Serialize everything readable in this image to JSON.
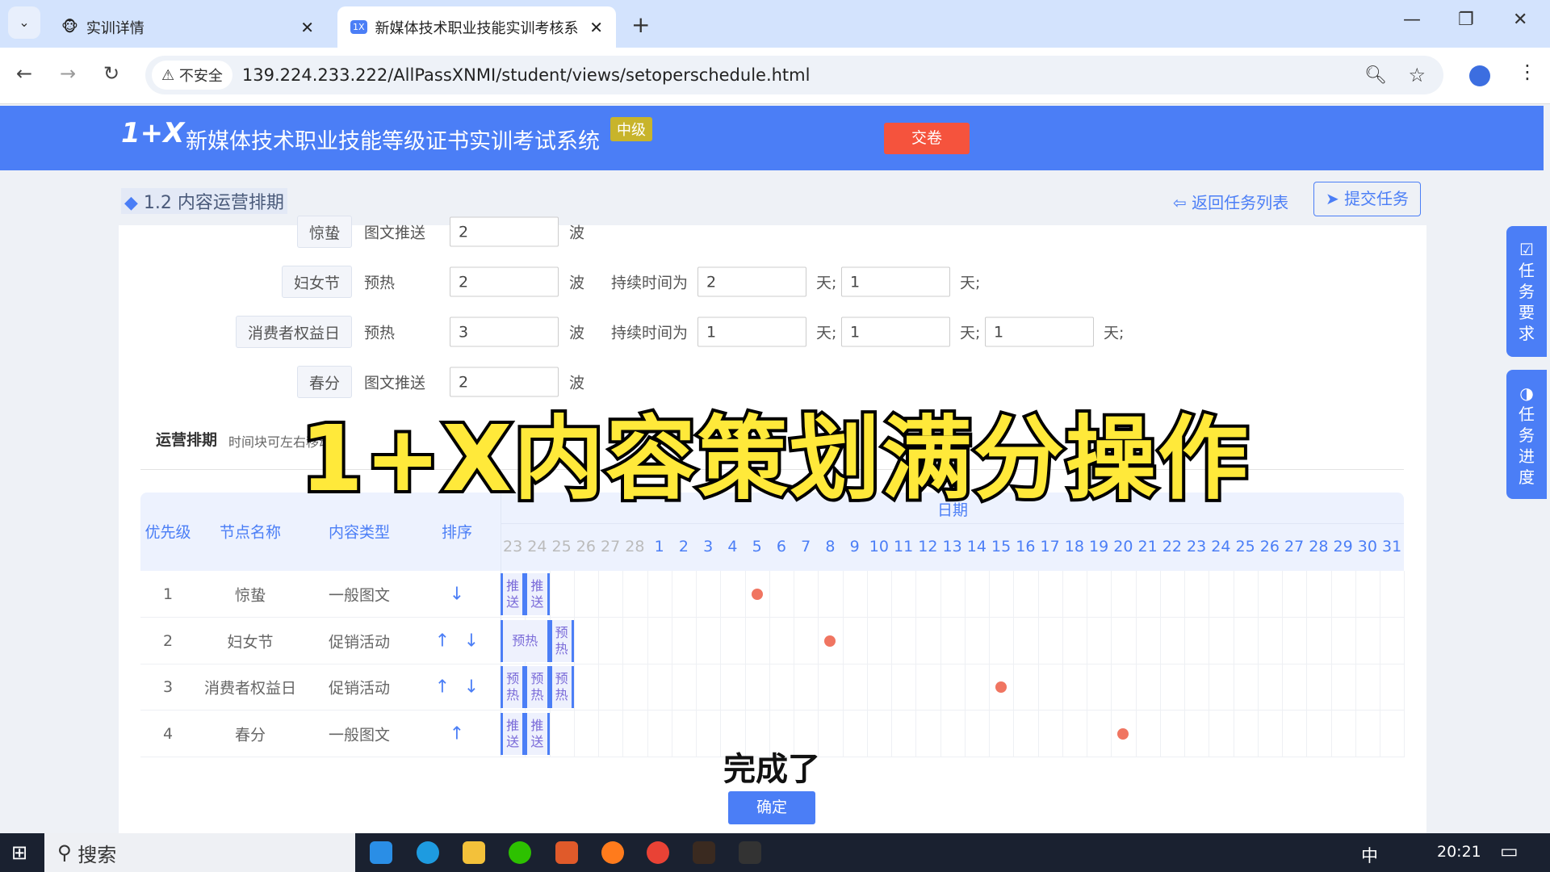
{
  "browser": {
    "tabs": [
      {
        "label": "实训详情"
      },
      {
        "label": "新媒体技术职业技能实训考核系"
      }
    ],
    "security": "不安全",
    "url": "139.224.233.222/AllPassXNMI/student/views/setoperschedule.html"
  },
  "header": {
    "logo": "1+X",
    "title": "新媒体技术职业技能等级证书实训考试系统",
    "level": "中级",
    "submit_exam": "交卷"
  },
  "sub": {
    "title": "1.2 内容运营排期",
    "back": "返回任务列表",
    "submit_task": "提交任务"
  },
  "form": {
    "rows": [
      {
        "node": "惊蛰",
        "type": "图文推送",
        "count": "2",
        "unit": "波",
        "durations": []
      },
      {
        "node": "妇女节",
        "type": "预热",
        "count": "2",
        "unit": "波",
        "duration_label": "持续时间为",
        "durations": [
          "2",
          "1"
        ],
        "day_unit": "天;"
      },
      {
        "node": "消费者权益日",
        "type": "预热",
        "count": "3",
        "unit": "波",
        "duration_label": "持续时间为",
        "durations": [
          "1",
          "1",
          "1"
        ],
        "day_unit": "天;"
      },
      {
        "node": "春分",
        "type": "图文推送",
        "count": "2",
        "unit": "波",
        "durations": []
      }
    ]
  },
  "schedule": {
    "label": "运营排期",
    "hint": "时间块可左右移动",
    "columns": [
      "优先级",
      "节点名称",
      "内容类型",
      "排序"
    ],
    "date_header": "日期",
    "prev_days": [
      "23",
      "24",
      "25",
      "26",
      "27",
      "28"
    ],
    "days": [
      "1",
      "2",
      "3",
      "4",
      "5",
      "6",
      "7",
      "8",
      "9",
      "10",
      "11",
      "12",
      "13",
      "14",
      "15",
      "16",
      "17",
      "18",
      "19",
      "20",
      "21",
      "22",
      "23",
      "24",
      "25",
      "26",
      "27",
      "28",
      "29",
      "30",
      "31"
    ],
    "rows": [
      {
        "priority": "1",
        "node": "惊蛰",
        "type": "一般图文",
        "up": false,
        "down": true,
        "node_day": 5,
        "blocks": [
          {
            "text": "推送",
            "start": 0,
            "span": 1
          },
          {
            "text": "推送",
            "start": 1,
            "span": 1
          }
        ]
      },
      {
        "priority": "2",
        "node": "妇女节",
        "type": "促销活动",
        "up": true,
        "down": true,
        "node_day": 8,
        "blocks": [
          {
            "text": "预热",
            "start": 0,
            "span": 2
          },
          {
            "text": "预热",
            "start": 2,
            "span": 1
          }
        ]
      },
      {
        "priority": "3",
        "node": "消费者权益日",
        "type": "促销活动",
        "up": true,
        "down": true,
        "node_day": 15,
        "blocks": [
          {
            "text": "预热",
            "start": 0,
            "span": 1
          },
          {
            "text": "预热",
            "start": 1,
            "span": 1
          },
          {
            "text": "预热",
            "start": 2,
            "span": 1
          }
        ]
      },
      {
        "priority": "4",
        "node": "春分",
        "type": "一般图文",
        "up": true,
        "down": false,
        "node_day": 20,
        "blocks": [
          {
            "text": "推送",
            "start": 0,
            "span": 1
          },
          {
            "text": "推送",
            "start": 1,
            "span": 1
          }
        ]
      }
    ]
  },
  "side": {
    "requirements": "任务要求",
    "progress": "任务进度"
  },
  "overlay": {
    "title": "1+X内容策划满分操作",
    "caption": "完成了"
  },
  "confirm": "确定",
  "taskbar": {
    "search": "搜索",
    "ime": "中",
    "time": "20:21"
  },
  "colors": {
    "primary": "#4b7ef6",
    "danger": "#f5533d",
    "dot": "#f07561"
  }
}
